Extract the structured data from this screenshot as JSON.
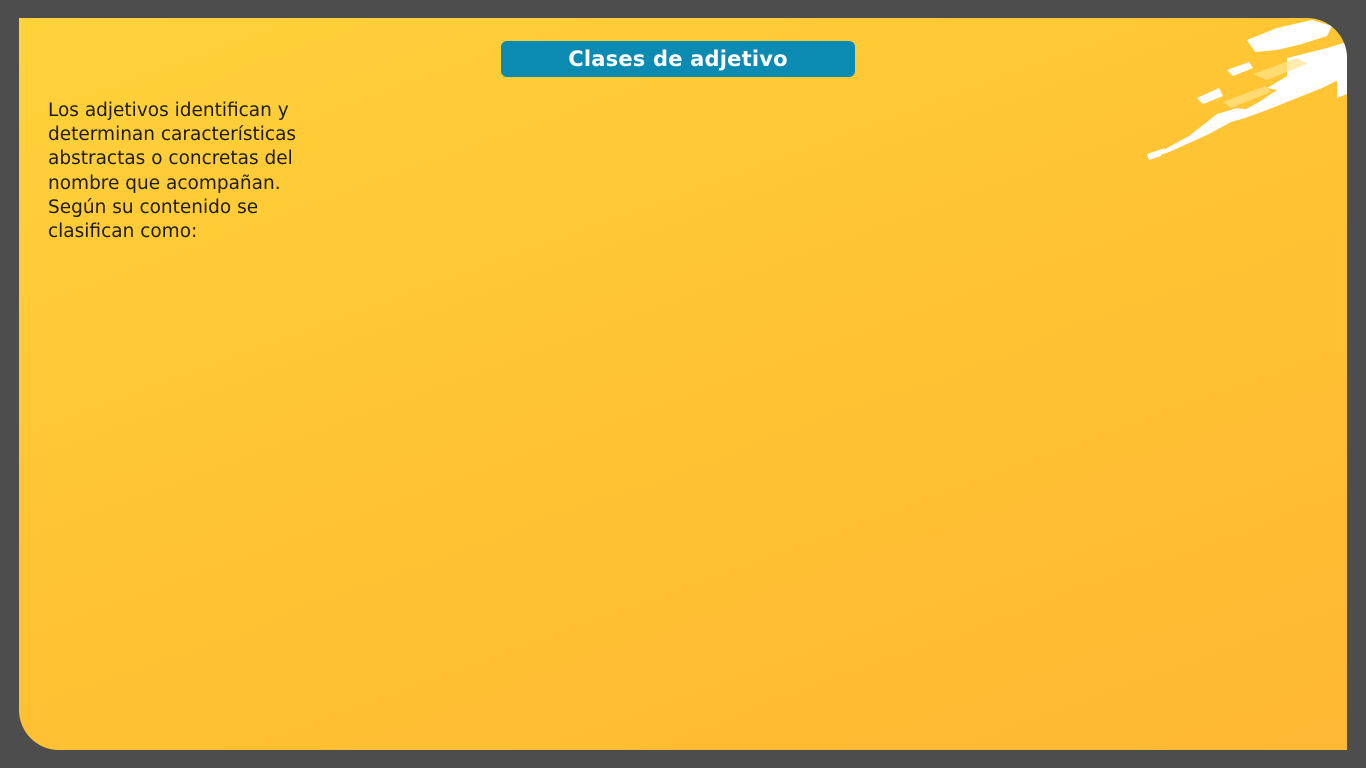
{
  "slide": {
    "title": "Clases de adjetivo",
    "body_lines": [
      "Los adjetivos identifican y",
      "determinan características",
      "abstractas o concretas del",
      "nombre que acompañan.",
      "Según su contenido se",
      "clasifican como:"
    ]
  },
  "colors": {
    "frame": "#4d4d4d",
    "slide_background": "#ffc433",
    "title_bar": "#0c8bb2",
    "title_text": "#ffffff",
    "body_text": "#1b1b1b",
    "splash": "#ffffff"
  },
  "decorations": {
    "corner_decoration": "white-paint-splash"
  }
}
